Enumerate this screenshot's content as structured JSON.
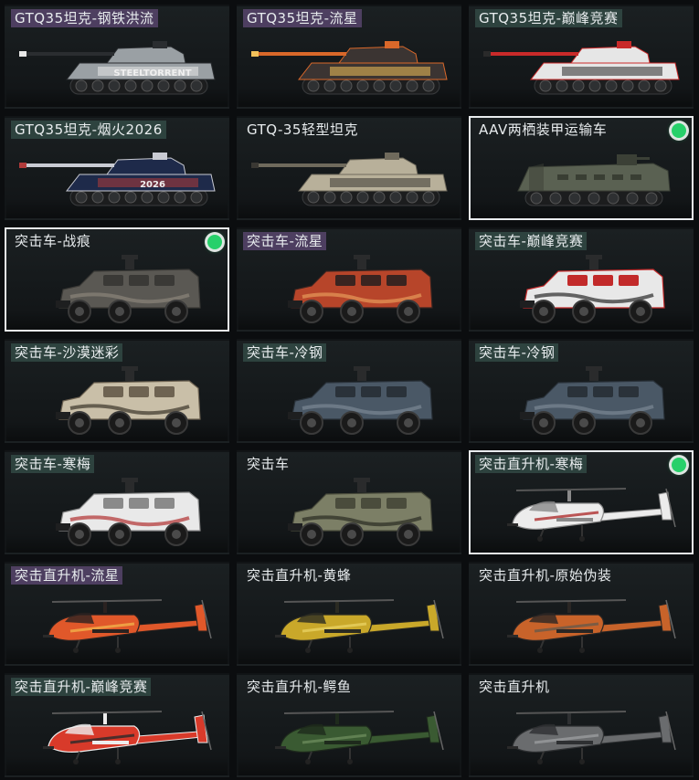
{
  "cards": [
    {
      "label": "GTQ35坦克-钢铁洪流",
      "kind": "tank",
      "rarity": "purple",
      "colors": [
        "#9aa0a4",
        "#2a2d30",
        "#e8e8e8"
      ],
      "equipped": false,
      "selected": false,
      "decal": "STEELTORRENT"
    },
    {
      "label": "GTQ35坦克-流星",
      "kind": "tank",
      "rarity": "purple",
      "colors": [
        "#3b3432",
        "#d9682a",
        "#f2c15a"
      ],
      "equipped": false,
      "selected": false
    },
    {
      "label": "GTQ35坦克-巅峰竞赛",
      "kind": "tank",
      "rarity": "teal",
      "colors": [
        "#e6e6e6",
        "#c92a2a",
        "#2a2a2a"
      ],
      "equipped": false,
      "selected": false
    },
    {
      "label": "GTQ35坦克-烟火2026",
      "kind": "tank",
      "rarity": "teal",
      "colors": [
        "#1e2a4a",
        "#c9cbd3",
        "#b03a3a"
      ],
      "equipped": false,
      "selected": false,
      "decal": "2026"
    },
    {
      "label": "GTQ-35轻型坦克",
      "kind": "tank",
      "rarity": "none",
      "colors": [
        "#b8b09a",
        "#6f6a5c",
        "#3a3833"
      ],
      "equipped": false,
      "selected": false
    },
    {
      "label": "AAV两栖装甲运输车",
      "kind": "aav",
      "rarity": "none",
      "colors": [
        "#5a6152",
        "#3b4036",
        "#23261f"
      ],
      "equipped": true,
      "selected": true
    },
    {
      "label": "突击车-战痕",
      "kind": "car",
      "rarity": "none",
      "colors": [
        "#5a5853",
        "#3a3936",
        "#8a857b"
      ],
      "equipped": true,
      "selected": true
    },
    {
      "label": "突击车-流星",
      "kind": "car",
      "rarity": "purple",
      "colors": [
        "#b7452a",
        "#3a2420",
        "#e59a5a"
      ],
      "equipped": false,
      "selected": false
    },
    {
      "label": "突击车-巅峰竞赛",
      "kind": "car",
      "rarity": "teal",
      "colors": [
        "#e8e8e8",
        "#c22a2a",
        "#2a2a2a"
      ],
      "equipped": false,
      "selected": false
    },
    {
      "label": "突击车-沙漠迷彩",
      "kind": "car",
      "rarity": "teal",
      "colors": [
        "#c9bfa8",
        "#6e6352",
        "#3a342a"
      ],
      "equipped": false,
      "selected": false
    },
    {
      "label": "突击车-冷钢",
      "kind": "car",
      "rarity": "teal",
      "colors": [
        "#4a5866",
        "#2a323a",
        "#7a8894"
      ],
      "equipped": false,
      "selected": false
    },
    {
      "label": "突击车-冷钢",
      "kind": "car",
      "rarity": "teal",
      "colors": [
        "#4a5866",
        "#2a323a",
        "#7a8894"
      ],
      "equipped": false,
      "selected": false
    },
    {
      "label": "突击车-寒梅",
      "kind": "car",
      "rarity": "teal",
      "colors": [
        "#e9e9e9",
        "#8a8a8a",
        "#b03030"
      ],
      "equipped": false,
      "selected": false
    },
    {
      "label": "突击车",
      "kind": "car",
      "rarity": "none",
      "colors": [
        "#7c7f66",
        "#4a4c3c",
        "#2a2b22"
      ],
      "equipped": false,
      "selected": false
    },
    {
      "label": "突击直升机-寒梅",
      "kind": "heli",
      "rarity": "teal",
      "colors": [
        "#ececec",
        "#8a8a8a",
        "#b03030"
      ],
      "equipped": true,
      "selected": true
    },
    {
      "label": "突击直升机-流星",
      "kind": "heli",
      "rarity": "purple",
      "colors": [
        "#e0582a",
        "#2a2220",
        "#f2b04a"
      ],
      "equipped": false,
      "selected": false
    },
    {
      "label": "突击直升机-黄蜂",
      "kind": "heli",
      "rarity": "none",
      "colors": [
        "#c9a82a",
        "#2a2a22",
        "#e8d060"
      ],
      "equipped": false,
      "selected": false
    },
    {
      "label": "突击直升机-原始伪装",
      "kind": "heli",
      "rarity": "none",
      "colors": [
        "#c8632a",
        "#2a2624",
        "#6a5a4a"
      ],
      "equipped": false,
      "selected": false
    },
    {
      "label": "突击直升机-巅峰竞赛",
      "kind": "heli",
      "rarity": "teal",
      "colors": [
        "#d83a2a",
        "#ededed",
        "#2a2a2a"
      ],
      "equipped": false,
      "selected": false
    },
    {
      "label": "突击直升机-鳄鱼",
      "kind": "heli",
      "rarity": "none",
      "colors": [
        "#3a5a32",
        "#1e2a1c",
        "#6a8a5a"
      ],
      "equipped": false,
      "selected": false
    },
    {
      "label": "突击直升机",
      "kind": "heli",
      "rarity": "none",
      "colors": [
        "#6a6c6e",
        "#2e3032",
        "#9a9c9e"
      ],
      "equipped": false,
      "selected": false
    }
  ]
}
